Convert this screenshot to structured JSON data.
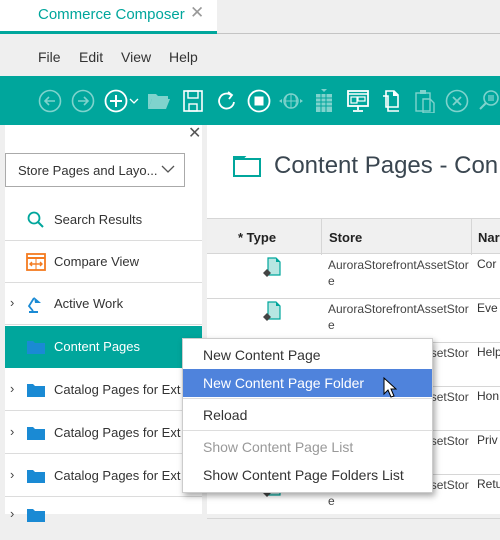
{
  "tab": {
    "title": "Commerce Composer",
    "close_icon": "close-icon"
  },
  "menubar": {
    "items": [
      "File",
      "Edit",
      "View",
      "Help"
    ]
  },
  "toolbar": {
    "icons": [
      "back-icon",
      "forward-icon",
      "add-icon",
      "add-dropdown-icon",
      "open-folder-icon",
      "save-icon",
      "refresh-icon",
      "stop-icon",
      "globe-icon",
      "grid-icon",
      "preview-icon",
      "copy-icon",
      "paste-icon",
      "cancel-icon",
      "search-zoom-icon"
    ]
  },
  "sidebar": {
    "selector_value": "Store Pages and Layo...",
    "items": [
      {
        "label": "Search Results",
        "icon": "search-icon",
        "expandable": false
      },
      {
        "label": "Compare View",
        "icon": "compare-icon",
        "expandable": false
      },
      {
        "label": "Active Work",
        "icon": "lamp-icon",
        "expandable": true
      },
      {
        "label": "Content Pages",
        "icon": "folder-icon",
        "expandable": false,
        "selected": true
      },
      {
        "label": "Catalog Pages for Ext",
        "icon": "folder-icon",
        "expandable": true
      },
      {
        "label": "Catalog Pages for Ext",
        "icon": "folder-icon",
        "expandable": true
      },
      {
        "label": "Catalog Pages for Ext",
        "icon": "folder-icon",
        "expandable": true
      }
    ]
  },
  "main": {
    "title": "Content Pages - Con",
    "columns": [
      "* Type",
      "Store",
      "Nar"
    ],
    "rows": [
      {
        "store": "AuroraStorefrontAssetStore",
        "name": "Cor"
      },
      {
        "store": "AuroraStorefrontAssetStore",
        "name": "Eve"
      },
      {
        "store": "AuroraStorefrontAssetStore",
        "name": "Help"
      },
      {
        "store": "AuroraStorefrontAssetStore",
        "name": "Hon"
      },
      {
        "store": "AuroraStorefrontAssetStore",
        "name": "Priv"
      },
      {
        "store": "AuroraStorefrontAssetStore",
        "name": "Retu"
      }
    ]
  },
  "context_menu": {
    "items": [
      {
        "label": "New Content Page",
        "state": "normal"
      },
      {
        "label": "New Content Page Folder",
        "state": "hover"
      },
      {
        "label": "Reload",
        "state": "normal"
      },
      {
        "label": "Show Content Page List",
        "state": "disabled"
      },
      {
        "label": "Show Content Page Folders List",
        "state": "normal"
      }
    ]
  },
  "colors": {
    "accent": "#00a69c",
    "menu_hover": "#4f83dc",
    "folder_blue": "#1a8ad4"
  }
}
